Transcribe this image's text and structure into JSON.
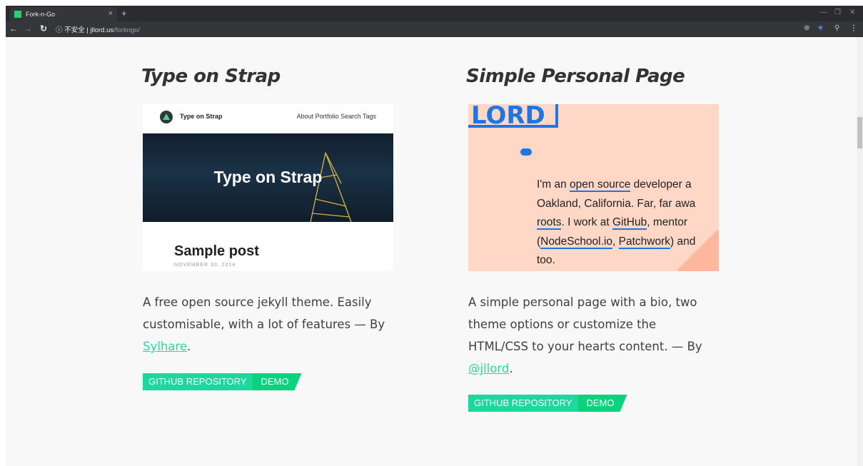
{
  "browser": {
    "tab_title": "Fork-n-Go",
    "tab_close": "×",
    "new_tab": "+",
    "security_label": "ⓘ 不安全",
    "url_host": "jllord.us",
    "url_path": "/forkngo/"
  },
  "cards": [
    {
      "title": "Type on Strap",
      "screenshot": {
        "brand": "Type on Strap",
        "nav": "About Portfolio Search Tags",
        "hero_title": "Type on Strap",
        "post_title": "Sample post",
        "post_date": "NOVEMBER 30, 2014"
      },
      "desc_text": "A free open source jekyll theme. Easily customisable, with a lot of features — By ",
      "author": "Sylhare",
      "desc_end": ".",
      "repo_label": "GITHUB REPOSITORY",
      "demo_label": "DEMO"
    },
    {
      "title": "Simple Personal Page",
      "screenshot": {
        "logo_text": "LORD",
        "l1a": "I'm an ",
        "l1b": "open source",
        "l1c": " developer a",
        "l2": "Oakland, California. Far, far awa",
        "l3a": "roots",
        "l3b": ". I work at ",
        "l3c": "GitHub",
        "l3d": ", mentor",
        "l4a": "(",
        "l4b": "NodeSchool.io",
        "l4c": ", ",
        "l4d": "Patchwork",
        "l4e": ") and",
        "l5": "too."
      },
      "desc_text": "A simple personal page with a bio, two theme options or customize the HTML/CSS to your hearts content. — By ",
      "author": "@jllord",
      "desc_end": ".",
      "repo_label": "GITHUB REPOSITORY",
      "demo_label": "DEMO"
    }
  ],
  "colors": {
    "accent": "#1cd89c",
    "accent2": "#0bd37d",
    "link": "#2bd89b"
  },
  "icons": [
    "back-icon",
    "forward-icon",
    "reload-icon",
    "info-icon",
    "zoom-icon",
    "star-icon",
    "extension-icon",
    "menu-icon",
    "minimize-icon",
    "maximize-icon",
    "close-icon"
  ]
}
